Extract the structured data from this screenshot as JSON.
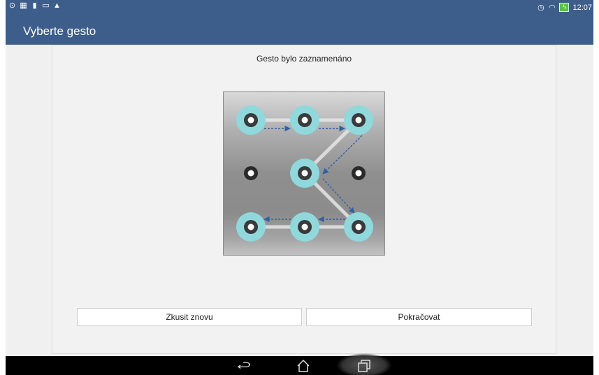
{
  "status_bar": {
    "left_icons": [
      "alarm-clock-icon",
      "screenshot-icon",
      "sim-card-icon",
      "photo-icon",
      "warning-icon"
    ],
    "right_icons": [
      "alarm-icon",
      "wifi-icon",
      "battery-charging-icon"
    ],
    "time": "12:07"
  },
  "app_bar": {
    "title": "Vyberte gesto"
  },
  "card": {
    "status_message": "Gesto bylo zaznamenáno",
    "retry_label": "Zkusit znovu",
    "continue_label": "Pokračovat"
  },
  "pattern": {
    "grid": "3x3",
    "selected_sequence": [
      1,
      2,
      3,
      5,
      9,
      8,
      7
    ],
    "selected_ring_color": "#8fd9dc",
    "line_color": "#e6e6e6",
    "arrow_color": "#2f5fa8"
  },
  "nav_bar": {
    "items": [
      "back-icon",
      "home-icon",
      "recent-apps-icon"
    ]
  }
}
